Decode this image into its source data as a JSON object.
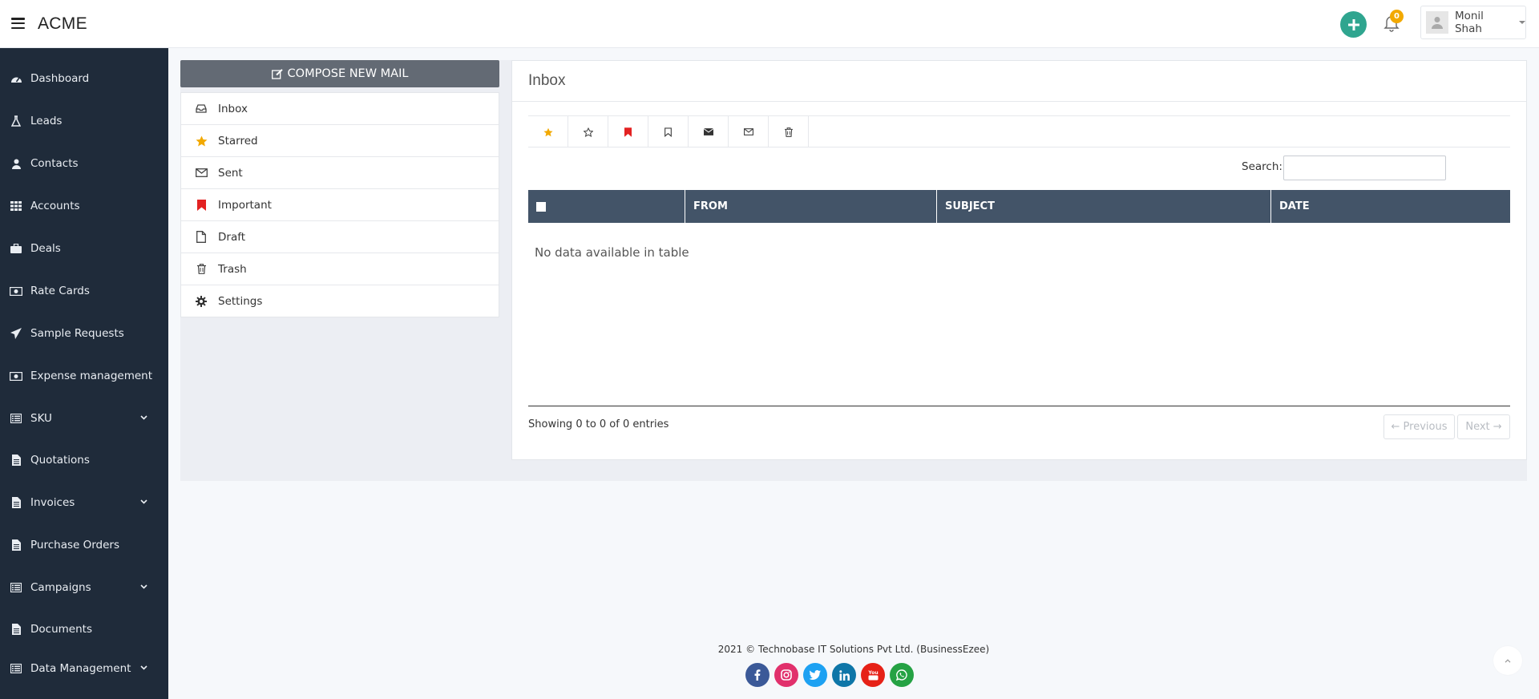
{
  "app": {
    "brand": "ACME"
  },
  "header": {
    "notifications_count": "0",
    "user_name": "Monil Shah"
  },
  "sidebar": {
    "items": [
      {
        "label": "Dashboard",
        "icon": "dashboard-icon"
      },
      {
        "label": "Leads",
        "icon": "flask-icon"
      },
      {
        "label": "Contacts",
        "icon": "user-icon"
      },
      {
        "label": "Accounts",
        "icon": "grid-icon"
      },
      {
        "label": "Deals",
        "icon": "briefcase-icon"
      },
      {
        "label": "Rate Cards",
        "icon": "money-icon"
      },
      {
        "label": "Sample Requests",
        "icon": "paper-plane-icon"
      },
      {
        "label": "Expense management",
        "icon": "money-icon"
      },
      {
        "label": "SKU",
        "icon": "list-icon",
        "has_submenu": true
      },
      {
        "label": "Quotations",
        "icon": "file-icon"
      },
      {
        "label": "Invoices",
        "icon": "file-icon",
        "has_submenu": true
      },
      {
        "label": "Purchase Orders",
        "icon": "file-icon"
      },
      {
        "label": "Campaigns",
        "icon": "list-icon",
        "has_submenu": true
      },
      {
        "label": "Documents",
        "icon": "file-icon"
      },
      {
        "label": "Data Management",
        "icon": "list-icon",
        "has_submenu": true
      }
    ]
  },
  "mail": {
    "compose_label": "COMPOSE NEW MAIL",
    "folders": [
      {
        "label": "Inbox",
        "icon": "inbox-icon"
      },
      {
        "label": "Starred",
        "icon": "star-icon",
        "color": "#f2a900"
      },
      {
        "label": "Sent",
        "icon": "envelope-outline-icon"
      },
      {
        "label": "Important",
        "icon": "bookmark-icon",
        "color": "#e32222"
      },
      {
        "label": "Draft",
        "icon": "file-outline-icon"
      },
      {
        "label": "Trash",
        "icon": "trash-icon"
      },
      {
        "label": "Settings",
        "icon": "gear-icon"
      }
    ]
  },
  "inbox": {
    "title": "Inbox",
    "toolbar": [
      "star-filled-icon",
      "star-outline-icon",
      "bookmark-filled-icon",
      "bookmark-outline-icon",
      "envelope-filled-icon",
      "envelope-outline-icon",
      "trash-icon"
    ],
    "search_label": "Search:",
    "search_value": "",
    "columns": [
      "",
      "FROM",
      "SUBJECT",
      "DATE"
    ],
    "empty_message": "No data available in table",
    "entries_info": "Showing 0 to 0 of 0 entries",
    "prev_label": "← Previous",
    "next_label": "Next →"
  },
  "footer": {
    "copyright": "2021 © Technobase IT Solutions Pvt Ltd. (BusinessEzee)",
    "socials": [
      {
        "name": "facebook-icon",
        "color": "#3b5998"
      },
      {
        "name": "instagram-icon",
        "color": "#e1306c"
      },
      {
        "name": "twitter-icon",
        "color": "#1da1f2"
      },
      {
        "name": "linkedin-icon",
        "color": "#0e76a8"
      },
      {
        "name": "youtube-icon",
        "color": "#e62117"
      },
      {
        "name": "whatsapp-icon",
        "color": "#25a244"
      }
    ]
  },
  "colors": {
    "sidebar_bg": "#1f2b3a",
    "table_header_bg": "#435468",
    "accent_green": "#2fa58f",
    "compose_bg": "#636a74"
  }
}
